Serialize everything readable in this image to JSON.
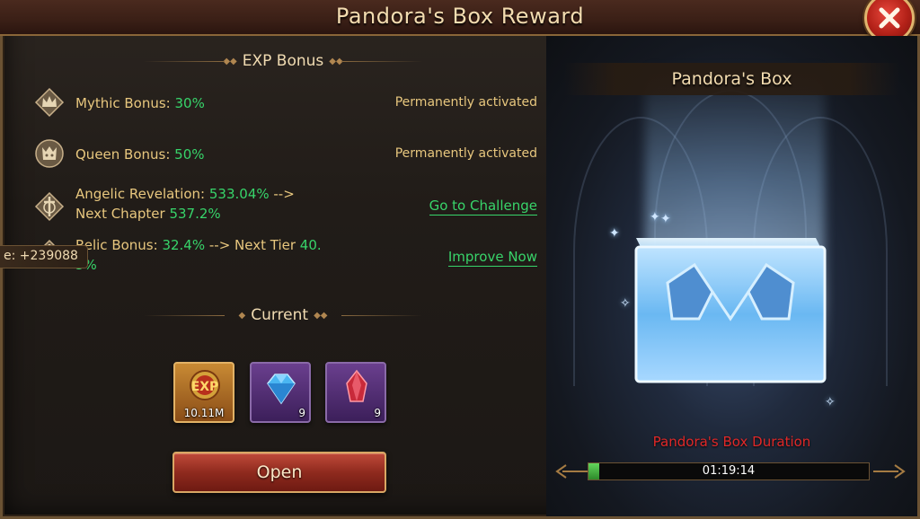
{
  "window": {
    "title": "Pandora's Box Reward"
  },
  "exp_bonus": {
    "header": "EXP Bonus",
    "rows": [
      {
        "label": "Mythic Bonus: ",
        "value": "30%",
        "status": "Permanently activated",
        "icon": "crown-icon"
      },
      {
        "label": "Queen Bonus: ",
        "value": "50%",
        "status": "Permanently activated",
        "icon": "queen-emblem-icon"
      },
      {
        "label": "Angelic Revelation: ",
        "value": "533.04%",
        "arrow": " -->",
        "next_label": "Next Chapter ",
        "next_value": "537.2%",
        "link": "Go to Challenge",
        "icon": "angel-sword-icon"
      },
      {
        "label": "Relic Bonus: ",
        "value": "32.4%",
        "arrow": " --> Next Tier ",
        "next_value_line1": "40.",
        "next_value_line2": "5%",
        "link": "Improve Now",
        "icon": "relic-sword-icon"
      }
    ]
  },
  "side_tag": {
    "text": "e: +239088"
  },
  "current": {
    "header": "Current",
    "items": [
      {
        "name": "exp-item",
        "icon": "exp-medal-icon",
        "count": "10.11M"
      },
      {
        "name": "diamond-item",
        "icon": "blue-diamond-icon",
        "count": "9"
      },
      {
        "name": "ruby-item",
        "icon": "red-crystal-icon",
        "count": "9"
      }
    ]
  },
  "open_button": {
    "label": "Open"
  },
  "pandora": {
    "title": "Pandora's Box",
    "duration_label": "Pandora's Box Duration",
    "timer": "01:19:14",
    "progress": 0.04
  },
  "colors": {
    "accent_gold": "#e8c77e",
    "value_green": "#37d46a",
    "duration_red": "#e02828",
    "button_red": "#8f2a1e"
  }
}
